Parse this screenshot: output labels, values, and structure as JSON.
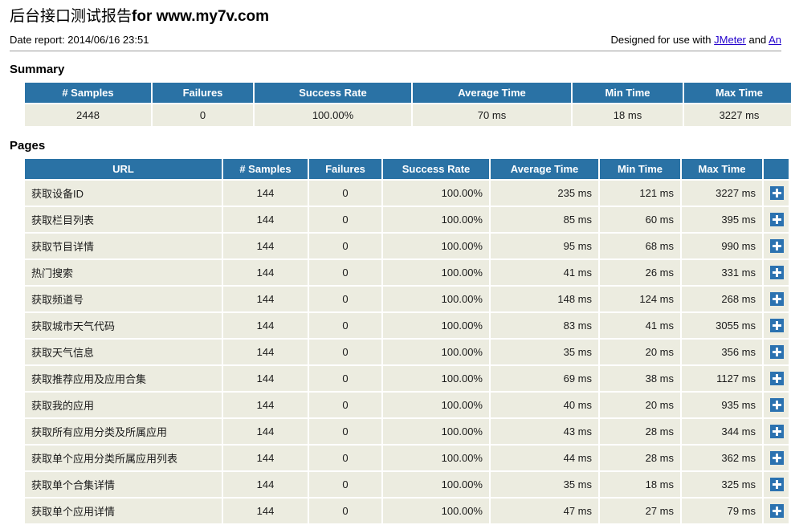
{
  "header": {
    "title_cjk": "后台接口测试报告",
    "title_ascii": "for www.my7v.com",
    "date_label": "Date report: 2014/06/16 23:51",
    "designed_prefix": "Designed for use with ",
    "designed_link1": "JMeter",
    "designed_middle": " and ",
    "designed_link2": "An"
  },
  "summary": {
    "section_title": "Summary",
    "columns": [
      "# Samples",
      "Failures",
      "Success Rate",
      "Average Time",
      "Min Time",
      "Max Time"
    ],
    "row": {
      "samples": "2448",
      "failures": "0",
      "success_rate": "100.00%",
      "average_time": "70 ms",
      "min_time": "18 ms",
      "max_time": "3227 ms"
    }
  },
  "pages": {
    "section_title": "Pages",
    "columns": [
      "URL",
      "# Samples",
      "Failures",
      "Success Rate",
      "Average Time",
      "Min Time",
      "Max Time",
      ""
    ],
    "expand_icon": "plus-icon",
    "rows": [
      {
        "url": "获取设备ID",
        "samples": "144",
        "failures": "0",
        "success_rate": "100.00%",
        "average_time": "235 ms",
        "min_time": "121 ms",
        "max_time": "3227 ms"
      },
      {
        "url": "获取栏目列表",
        "samples": "144",
        "failures": "0",
        "success_rate": "100.00%",
        "average_time": "85 ms",
        "min_time": "60 ms",
        "max_time": "395 ms"
      },
      {
        "url": "获取节目详情",
        "samples": "144",
        "failures": "0",
        "success_rate": "100.00%",
        "average_time": "95 ms",
        "min_time": "68 ms",
        "max_time": "990 ms"
      },
      {
        "url": "热门搜索",
        "samples": "144",
        "failures": "0",
        "success_rate": "100.00%",
        "average_time": "41 ms",
        "min_time": "26 ms",
        "max_time": "331 ms"
      },
      {
        "url": "获取频道号",
        "samples": "144",
        "failures": "0",
        "success_rate": "100.00%",
        "average_time": "148 ms",
        "min_time": "124 ms",
        "max_time": "268 ms"
      },
      {
        "url": "获取城市天气代码",
        "samples": "144",
        "failures": "0",
        "success_rate": "100.00%",
        "average_time": "83 ms",
        "min_time": "41 ms",
        "max_time": "3055 ms"
      },
      {
        "url": "获取天气信息",
        "samples": "144",
        "failures": "0",
        "success_rate": "100.00%",
        "average_time": "35 ms",
        "min_time": "20 ms",
        "max_time": "356 ms"
      },
      {
        "url": "获取推荐应用及应用合集",
        "samples": "144",
        "failures": "0",
        "success_rate": "100.00%",
        "average_time": "69 ms",
        "min_time": "38 ms",
        "max_time": "1127 ms"
      },
      {
        "url": "获取我的应用",
        "samples": "144",
        "failures": "0",
        "success_rate": "100.00%",
        "average_time": "40 ms",
        "min_time": "20 ms",
        "max_time": "935 ms"
      },
      {
        "url": "获取所有应用分类及所属应用",
        "samples": "144",
        "failures": "0",
        "success_rate": "100.00%",
        "average_time": "43 ms",
        "min_time": "28 ms",
        "max_time": "344 ms"
      },
      {
        "url": "获取单个应用分类所属应用列表",
        "samples": "144",
        "failures": "0",
        "success_rate": "100.00%",
        "average_time": "44 ms",
        "min_time": "28 ms",
        "max_time": "362 ms"
      },
      {
        "url": "获取单个合集详情",
        "samples": "144",
        "failures": "0",
        "success_rate": "100.00%",
        "average_time": "35 ms",
        "min_time": "18 ms",
        "max_time": "325 ms"
      },
      {
        "url": "获取单个应用详情",
        "samples": "144",
        "failures": "0",
        "success_rate": "100.00%",
        "average_time": "47 ms",
        "min_time": "27 ms",
        "max_time": "79 ms"
      }
    ]
  },
  "colors": {
    "header_blue": "#2a72a5",
    "row_bg": "#ecece0",
    "expand_blue": "#2b72b0",
    "link": "#2200cc"
  }
}
